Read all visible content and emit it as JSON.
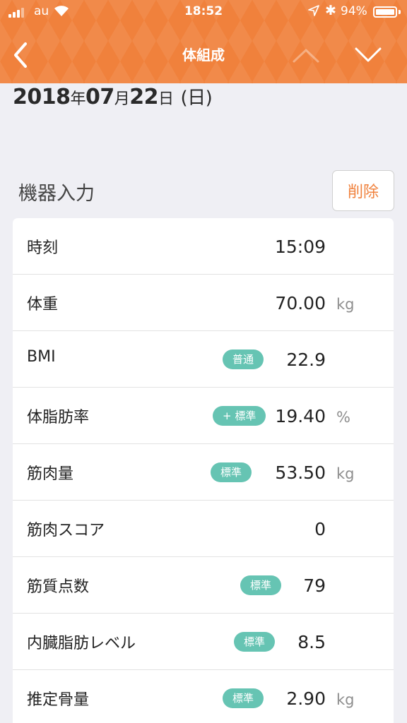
{
  "status_bar": {
    "carrier": "au",
    "time": "18:52",
    "battery_percent_label": "94%",
    "battery_level": 0.94
  },
  "nav": {
    "title": "体組成"
  },
  "date": {
    "year": "2018",
    "year_suffix": "年",
    "month": "07",
    "month_suffix": "月",
    "day": "22",
    "day_suffix": "日",
    "weekday": "(日)"
  },
  "section": {
    "title": "機器入力",
    "delete_label": "削除"
  },
  "rows": [
    {
      "label": "時刻",
      "value": "15:09",
      "unit": "",
      "badge": ""
    },
    {
      "label": "体重",
      "value": "70.00",
      "unit": "kg",
      "badge": ""
    },
    {
      "label": "BMI",
      "value": "22.9",
      "unit": "",
      "badge": "普通"
    },
    {
      "label": "体脂肪率",
      "value": "19.40",
      "unit": "%",
      "badge": "+ 標準"
    },
    {
      "label": "筋肉量",
      "value": "53.50",
      "unit": "kg",
      "badge": "標準"
    },
    {
      "label": "筋肉スコア",
      "value": "0",
      "unit": "",
      "badge": ""
    },
    {
      "label": "筋質点数",
      "value": "79",
      "unit": "",
      "badge": "標準"
    },
    {
      "label": "内臓脂肪レベル",
      "value": "8.5",
      "unit": "",
      "badge": "標準"
    },
    {
      "label": "推定骨量",
      "value": "2.90",
      "unit": "kg",
      "badge": "標準"
    }
  ],
  "colors": {
    "accent": "#f0813c",
    "badge": "#66c4b3",
    "background": "#efeff4"
  }
}
